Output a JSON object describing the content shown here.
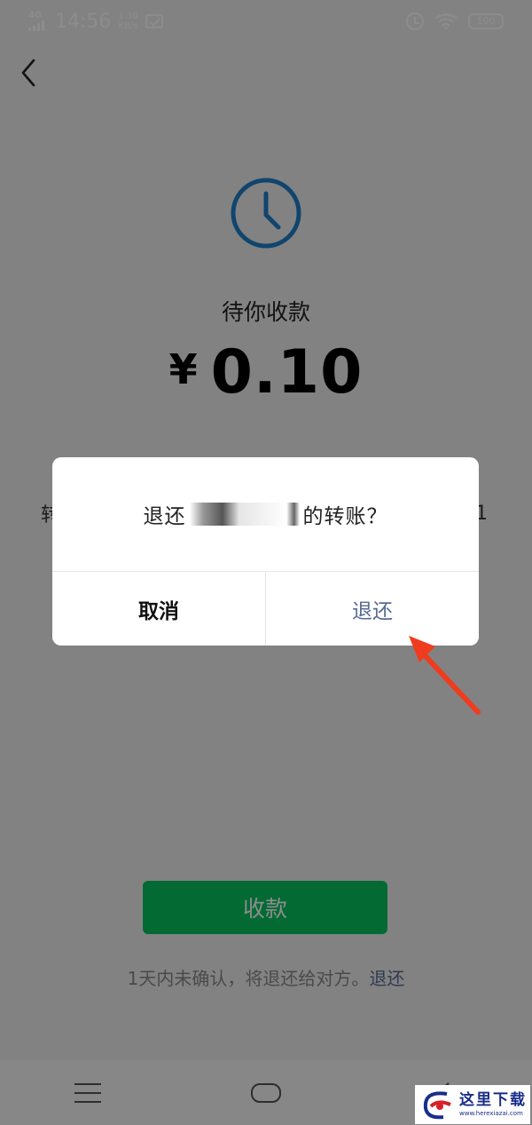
{
  "status_bar": {
    "network": "4G",
    "time": "14:56",
    "speed_value": "1.30",
    "speed_unit": "KB/s",
    "battery": "100"
  },
  "transfer": {
    "status_label": "待你收款",
    "currency": "¥",
    "amount": "0.10",
    "edge_left": "转",
    "edge_right": "1"
  },
  "receive_button_label": "收款",
  "notice": {
    "text": "1天内未确认，将退还给对方。",
    "link": "退还"
  },
  "dialog": {
    "message_prefix": "退还",
    "message_suffix": "的转账？",
    "cancel_label": "取消",
    "confirm_label": "退还"
  },
  "watermark": {
    "name": "这里下载",
    "url": "www.herexiazai.com"
  },
  "colors": {
    "primary_green": "#07c160",
    "link_blue": "#576b95",
    "clock_blue": "#1f7fc6",
    "arrow_red": "#f03c1e"
  }
}
